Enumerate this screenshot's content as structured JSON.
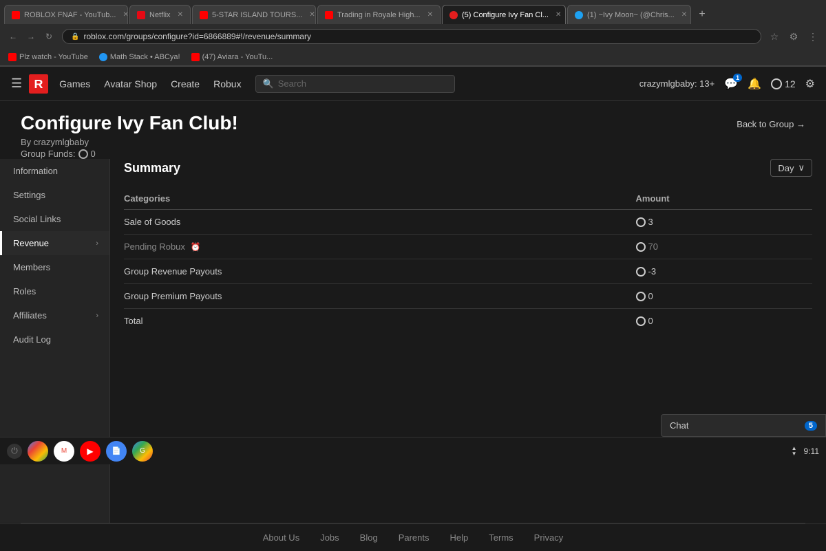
{
  "browser": {
    "tabs": [
      {
        "label": "ROBLOX FNAF - YouTub...",
        "favicon": "youtube",
        "active": false,
        "id": "tab-roblox-fnaf"
      },
      {
        "label": "Netflix",
        "favicon": "netflix",
        "active": false,
        "id": "tab-netflix"
      },
      {
        "label": "5-STAR ISLAND TOURS...",
        "favicon": "youtube",
        "active": false,
        "id": "tab-5star"
      },
      {
        "label": "Trading in Royale High...",
        "favicon": "youtube",
        "active": false,
        "id": "tab-trading"
      },
      {
        "label": "(5) Configure Ivy Fan Cl...",
        "favicon": "roblox",
        "active": true,
        "id": "tab-configure"
      },
      {
        "label": "(1) ~Ivy Moon~ (@Chris...",
        "favicon": "twitter",
        "active": false,
        "id": "tab-twitter"
      }
    ],
    "url": "roblox.com/groups/configure?id=6866889#!/revenue/summary",
    "bookmarks": [
      {
        "label": "Plz watch - YouTube",
        "favicon": "bm-yt"
      },
      {
        "label": "Math Stack • ABCya!",
        "favicon": "bm-math"
      },
      {
        "label": "(47) Aviara - YouTu...",
        "favicon": "bm-yt2"
      }
    ]
  },
  "navbar": {
    "menu_icon": "☰",
    "links": [
      "Games",
      "Avatar Shop",
      "Create",
      "Robux"
    ],
    "search_placeholder": "Search",
    "username": "crazymlgbaby: 13+",
    "robux_count": "12",
    "message_badge": "1"
  },
  "page": {
    "title": "Configure Ivy Fan Club!",
    "by_label": "By",
    "author": "crazymlgbaby",
    "funds_label": "Group Funds:",
    "funds_value": "0",
    "back_link": "Back to Group →"
  },
  "sidebar": {
    "items": [
      {
        "label": "Information",
        "active": false,
        "has_arrow": false,
        "id": "information"
      },
      {
        "label": "Settings",
        "active": false,
        "has_arrow": false,
        "id": "settings"
      },
      {
        "label": "Social Links",
        "active": false,
        "has_arrow": false,
        "id": "social-links"
      },
      {
        "label": "Revenue",
        "active": true,
        "has_arrow": true,
        "id": "revenue"
      },
      {
        "label": "Members",
        "active": false,
        "has_arrow": false,
        "id": "members"
      },
      {
        "label": "Roles",
        "active": false,
        "has_arrow": false,
        "id": "roles"
      },
      {
        "label": "Affiliates",
        "active": false,
        "has_arrow": true,
        "id": "affiliates"
      },
      {
        "label": "Audit Log",
        "active": false,
        "has_arrow": false,
        "id": "audit-log"
      }
    ]
  },
  "summary": {
    "title": "Summary",
    "day_label": "Day",
    "categories_header": "Categories",
    "amount_header": "Amount",
    "rows": [
      {
        "label": "Sale of Goods",
        "amount": "3",
        "pending": false,
        "id": "sale-of-goods"
      },
      {
        "label": "Pending Robux",
        "amount": "70",
        "pending": true,
        "id": "pending-robux"
      },
      {
        "label": "Group Revenue Payouts",
        "amount": "-3",
        "pending": false,
        "id": "revenue-payouts"
      },
      {
        "label": "Group Premium Payouts",
        "amount": "0",
        "pending": false,
        "id": "premium-payouts"
      },
      {
        "label": "Total",
        "amount": "0",
        "pending": false,
        "id": "total",
        "is_total": true
      }
    ]
  },
  "footer": {
    "links": [
      "About Us",
      "Jobs",
      "Blog",
      "Parents",
      "Help",
      "Terms",
      "Privacy"
    ]
  },
  "chat": {
    "label": "Chat",
    "count": "5"
  },
  "taskbar": {
    "time": "9:11",
    "apps": [
      {
        "name": "Chrome",
        "class": "taskbar-chrome"
      },
      {
        "name": "Gmail",
        "class": "taskbar-gmail"
      },
      {
        "name": "YouTube",
        "class": "taskbar-youtube"
      },
      {
        "name": "Docs",
        "class": "taskbar-docs"
      },
      {
        "name": "Google",
        "class": "taskbar-search"
      }
    ]
  }
}
